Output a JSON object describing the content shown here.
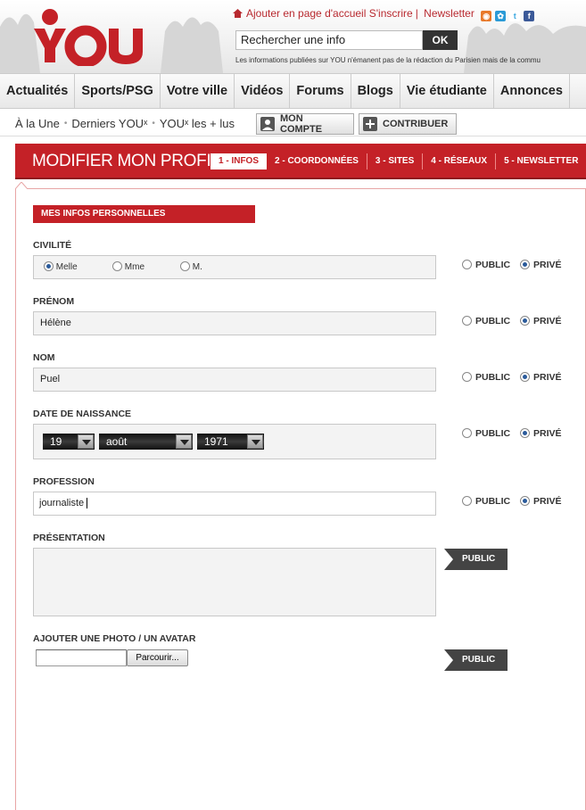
{
  "header": {
    "logo_text": "YOU",
    "links": {
      "home": "Ajouter en page d'accueil",
      "signup": "S'inscrire",
      "newsletter": "Newsletter"
    },
    "search_value": "Rechercher une info",
    "search_button": "OK",
    "disclaimer": "Les informations publiées sur YOU n'émanent pas de la rédaction du Parisien mais de la commu"
  },
  "nav": [
    "Actualités",
    "Sports/PSG",
    "Votre ville",
    "Vidéos",
    "Forums",
    "Blogs",
    "Vie étudiante",
    "Annonces"
  ],
  "subnav": {
    "a_la_une": "À la Une",
    "derniers": "Derniers YOUˣ",
    "les_plus": "YOUˣ les + lus",
    "mon_compte": "MON COMPTE",
    "contribuer": "CONTRIBUER"
  },
  "banner": {
    "title": "MODIFIER MON PROFIL",
    "tabs": [
      "1 - INFOS",
      "2 - COORDONNÉES",
      "3 - SITES",
      "4 - RÉSEAUX",
      "5 - NEWSLETTER"
    ]
  },
  "form": {
    "section": "MES INFOS PERSONNELLES",
    "civilite_label": "CIVILITÉ",
    "civilite_options": [
      "Melle",
      "Mme",
      "M."
    ],
    "civilite_selected": "Melle",
    "prenom_label": "PRÉNOM",
    "prenom_value": "Hélène",
    "nom_label": "NOM",
    "nom_value": "Puel",
    "dob_label": "DATE DE NAISSANCE",
    "dob_day": "19",
    "dob_month": "août",
    "dob_year": "1971",
    "profession_label": "PROFESSION",
    "profession_value": "journaliste",
    "presentation_label": "PRÉSENTATION",
    "photo_label": "AJOUTER UNE PHOTO / UN AVATAR",
    "browse_button": "Parcourir...",
    "public_label": "PUBLIC",
    "prive_label": "PRIVÉ",
    "public_tag": "PUBLIC"
  },
  "colors": {
    "brand_red": "#c42127",
    "dark": "#444444"
  }
}
